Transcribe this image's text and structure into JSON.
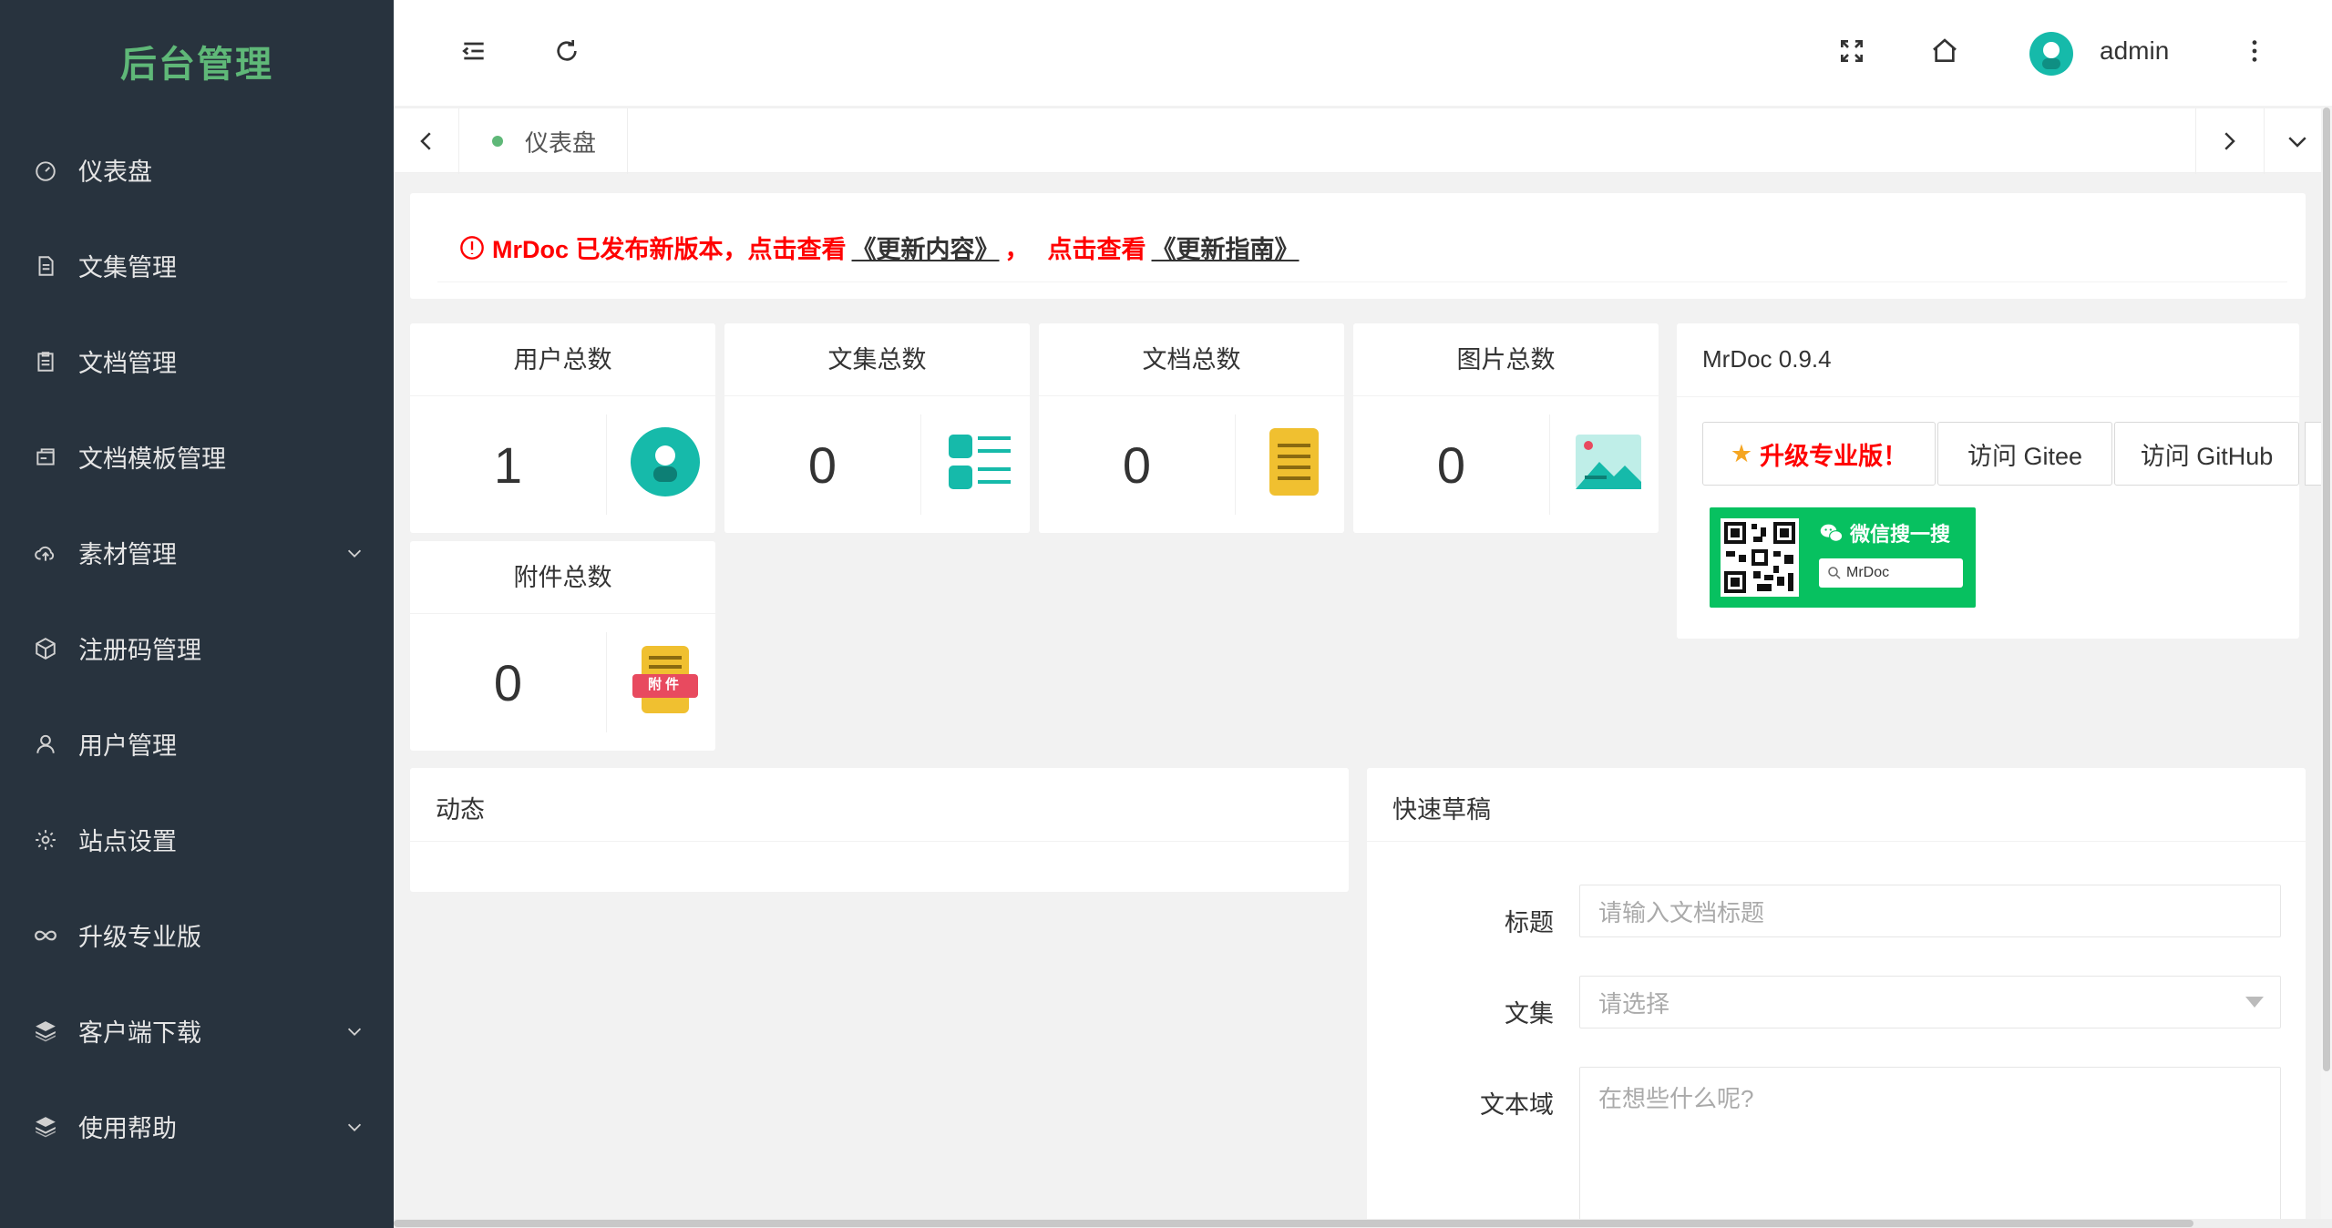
{
  "sidebar": {
    "logo": "后台管理",
    "items": [
      {
        "label": "仪表盘",
        "icon": "dashboard-icon"
      },
      {
        "label": "文集管理",
        "icon": "document-icon"
      },
      {
        "label": "文档管理",
        "icon": "doc-list-icon"
      },
      {
        "label": "文档模板管理",
        "icon": "template-icon"
      },
      {
        "label": "素材管理",
        "icon": "upload-cloud-icon",
        "expandable": true
      },
      {
        "label": "注册码管理",
        "icon": "cube-icon"
      },
      {
        "label": "用户管理",
        "icon": "user-icon"
      },
      {
        "label": "站点设置",
        "icon": "gear-icon"
      },
      {
        "label": "升级专业版",
        "icon": "infinity-icon"
      },
      {
        "label": "客户端下载",
        "icon": "layers-icon",
        "expandable": true
      },
      {
        "label": "使用帮助",
        "icon": "layers-icon",
        "expandable": true
      }
    ]
  },
  "header": {
    "username": "admin"
  },
  "tabs": {
    "active": "仪表盘"
  },
  "notice": {
    "text1": "MrDoc 已发布新版本，点击查看",
    "link1": "《更新内容》",
    "sep": "，",
    "text2": "点击查看",
    "link2": "《更新指南》"
  },
  "stats": [
    {
      "title": "用户总数",
      "value": "1",
      "icon": "user-avatar-icon"
    },
    {
      "title": "文集总数",
      "value": "0",
      "icon": "list-icon"
    },
    {
      "title": "文档总数",
      "value": "0",
      "icon": "document-icon"
    },
    {
      "title": "图片总数",
      "value": "0",
      "icon": "image-icon"
    },
    {
      "title": "附件总数",
      "value": "0",
      "icon": "attachment-icon",
      "badge": "附件"
    }
  ],
  "info": {
    "title": "MrDoc 0.9.4",
    "upgrade_button": "升级专业版！",
    "gitee_button": "访问 Gitee",
    "github_button": "访问 GitHub",
    "wechat_title": "微信搜一搜",
    "wechat_search": "MrDoc"
  },
  "activity": {
    "title": "动态"
  },
  "draft": {
    "title": "快速草稿",
    "title_label": "标题",
    "title_placeholder": "请输入文档标题",
    "project_label": "文集",
    "project_placeholder": "请选择",
    "content_label": "文本域",
    "content_placeholder": "在想些什么呢?"
  },
  "colors": {
    "sidebar_bg": "#28333e",
    "logo": "#5fb878",
    "accent_teal": "#16baaa",
    "notice_red": "#ff0000",
    "wechat_green": "#07c160"
  }
}
